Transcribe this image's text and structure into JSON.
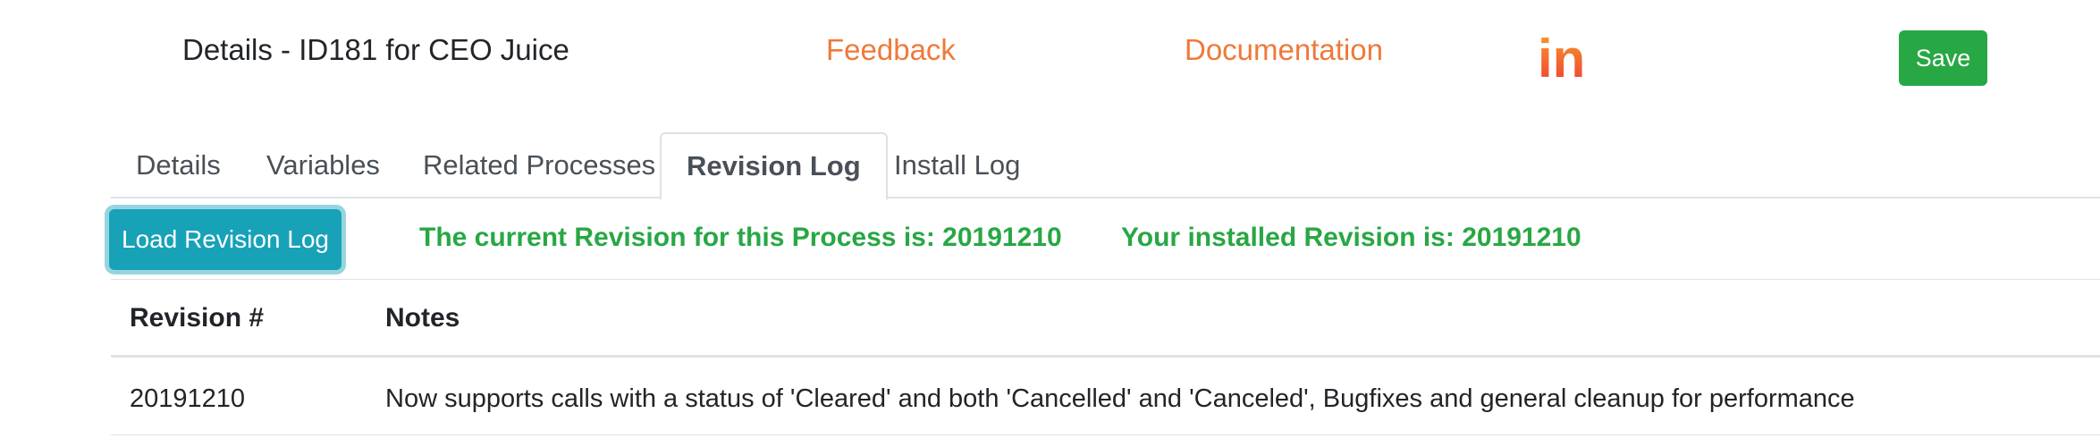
{
  "header": {
    "title": "Details - ID181 for CEO Juice",
    "feedback_label": "Feedback",
    "documentation_label": "Documentation",
    "logo_text": "in",
    "save_label": "Save"
  },
  "tabs": [
    {
      "label": "Details",
      "active": false
    },
    {
      "label": "Variables",
      "active": false
    },
    {
      "label": "Related Processes",
      "active": false
    },
    {
      "label": "Revision Log",
      "active": true
    },
    {
      "label": "Install Log",
      "active": false
    }
  ],
  "revision": {
    "load_button_label": "Load Revision Log",
    "current_text": "The current Revision for this Process is: 20191210",
    "installed_text": "Your installed Revision is: 20191210"
  },
  "table": {
    "columns": [
      "Revision #",
      "Notes"
    ],
    "rows": [
      {
        "revision": "20191210",
        "notes": "Now supports calls with a status of 'Cleared' and both 'Cancelled' and 'Canceled', Bugfixes and general cleanup for performance"
      }
    ]
  },
  "colors": {
    "accent_orange": "#f0793a",
    "success_green": "#28a745",
    "info_teal": "#17a2b8"
  }
}
